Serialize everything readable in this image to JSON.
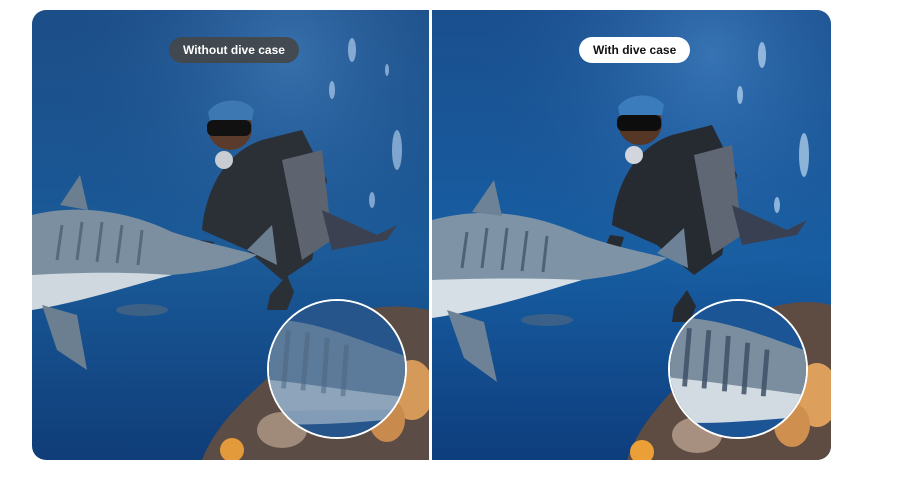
{
  "comparison": {
    "left_label": "Without dive case",
    "right_label": "With dive case"
  },
  "colors": {
    "water_top": "#1f4f86",
    "water_bottom": "#0e3a74",
    "shark": "#6f8394",
    "coral": "#d59a5a"
  },
  "icons": {
    "diver": "scuba-diver-figure",
    "shark": "tiger-shark-figure",
    "zoom": "magnifier-circle"
  }
}
